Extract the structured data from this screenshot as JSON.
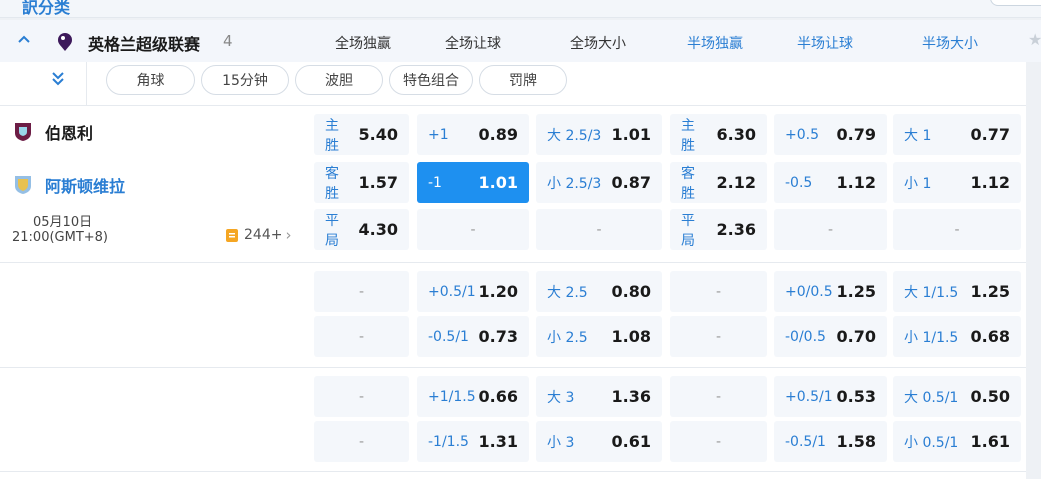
{
  "top": {
    "partial_title": "訳分类"
  },
  "league": {
    "name": "英格兰超级联赛",
    "count": "4",
    "columns": [
      "全场独赢",
      "全场让球",
      "全场大小",
      "半场独赢",
      "半场让球",
      "半场大小"
    ]
  },
  "filters": [
    "角球",
    "15分钟",
    "波胆",
    "特色组合",
    "罚牌"
  ],
  "match": {
    "home": "伯恩利",
    "away": "阿斯顿维拉",
    "date": "05月10日",
    "time": "21:00(GMT+8)",
    "more_count": "244+"
  },
  "odds": {
    "r0": [
      {
        "l": "主胜",
        "v": "5.40"
      },
      {
        "l": "+1",
        "v": "0.89"
      },
      {
        "l": "大 2.5/3",
        "v": "1.01"
      },
      {
        "l": "主胜",
        "v": "6.30"
      },
      {
        "l": "+0.5",
        "v": "0.79"
      },
      {
        "l": "大 1",
        "v": "0.77"
      }
    ],
    "r1": [
      {
        "l": "客胜",
        "v": "1.57"
      },
      {
        "l": "-1",
        "v": "1.01"
      },
      {
        "l": "小 2.5/3",
        "v": "0.87"
      },
      {
        "l": "客胜",
        "v": "2.12"
      },
      {
        "l": "-0.5",
        "v": "1.12"
      },
      {
        "l": "小 1",
        "v": "1.12"
      }
    ],
    "r2": [
      {
        "l": "平局",
        "v": "4.30"
      },
      {
        "l": "",
        "v": "-"
      },
      {
        "l": "",
        "v": "-"
      },
      {
        "l": "平局",
        "v": "2.36"
      },
      {
        "l": "",
        "v": "-"
      },
      {
        "l": "",
        "v": "-"
      }
    ],
    "r3": [
      {
        "l": "",
        "v": "-"
      },
      {
        "l": "+0.5/1",
        "v": "1.20"
      },
      {
        "l": "大 2.5",
        "v": "0.80"
      },
      {
        "l": "",
        "v": "-"
      },
      {
        "l": "+0/0.5",
        "v": "1.25"
      },
      {
        "l": "大 1/1.5",
        "v": "1.25"
      }
    ],
    "r4": [
      {
        "l": "",
        "v": "-"
      },
      {
        "l": "-0.5/1",
        "v": "0.73"
      },
      {
        "l": "小 2.5",
        "v": "1.08"
      },
      {
        "l": "",
        "v": "-"
      },
      {
        "l": "-0/0.5",
        "v": "0.70"
      },
      {
        "l": "小 1/1.5",
        "v": "0.68"
      }
    ],
    "r5": [
      {
        "l": "",
        "v": "-"
      },
      {
        "l": "+1/1.5",
        "v": "0.66"
      },
      {
        "l": "大 3",
        "v": "1.36"
      },
      {
        "l": "",
        "v": "-"
      },
      {
        "l": "+0.5/1",
        "v": "0.53"
      },
      {
        "l": "大 0.5/1",
        "v": "0.50"
      }
    ],
    "r6": [
      {
        "l": "",
        "v": "-"
      },
      {
        "l": "-1/1.5",
        "v": "1.31"
      },
      {
        "l": "小 3",
        "v": "0.61"
      },
      {
        "l": "",
        "v": "-"
      },
      {
        "l": "-0.5/1",
        "v": "1.58"
      },
      {
        "l": "小 0.5/1",
        "v": "1.61"
      }
    ]
  },
  "selected": "r1.1",
  "colors": {
    "accent": "#2a7ed3",
    "selected_bg": "#1e90f0",
    "cell_bg": "#f4f7fb"
  }
}
